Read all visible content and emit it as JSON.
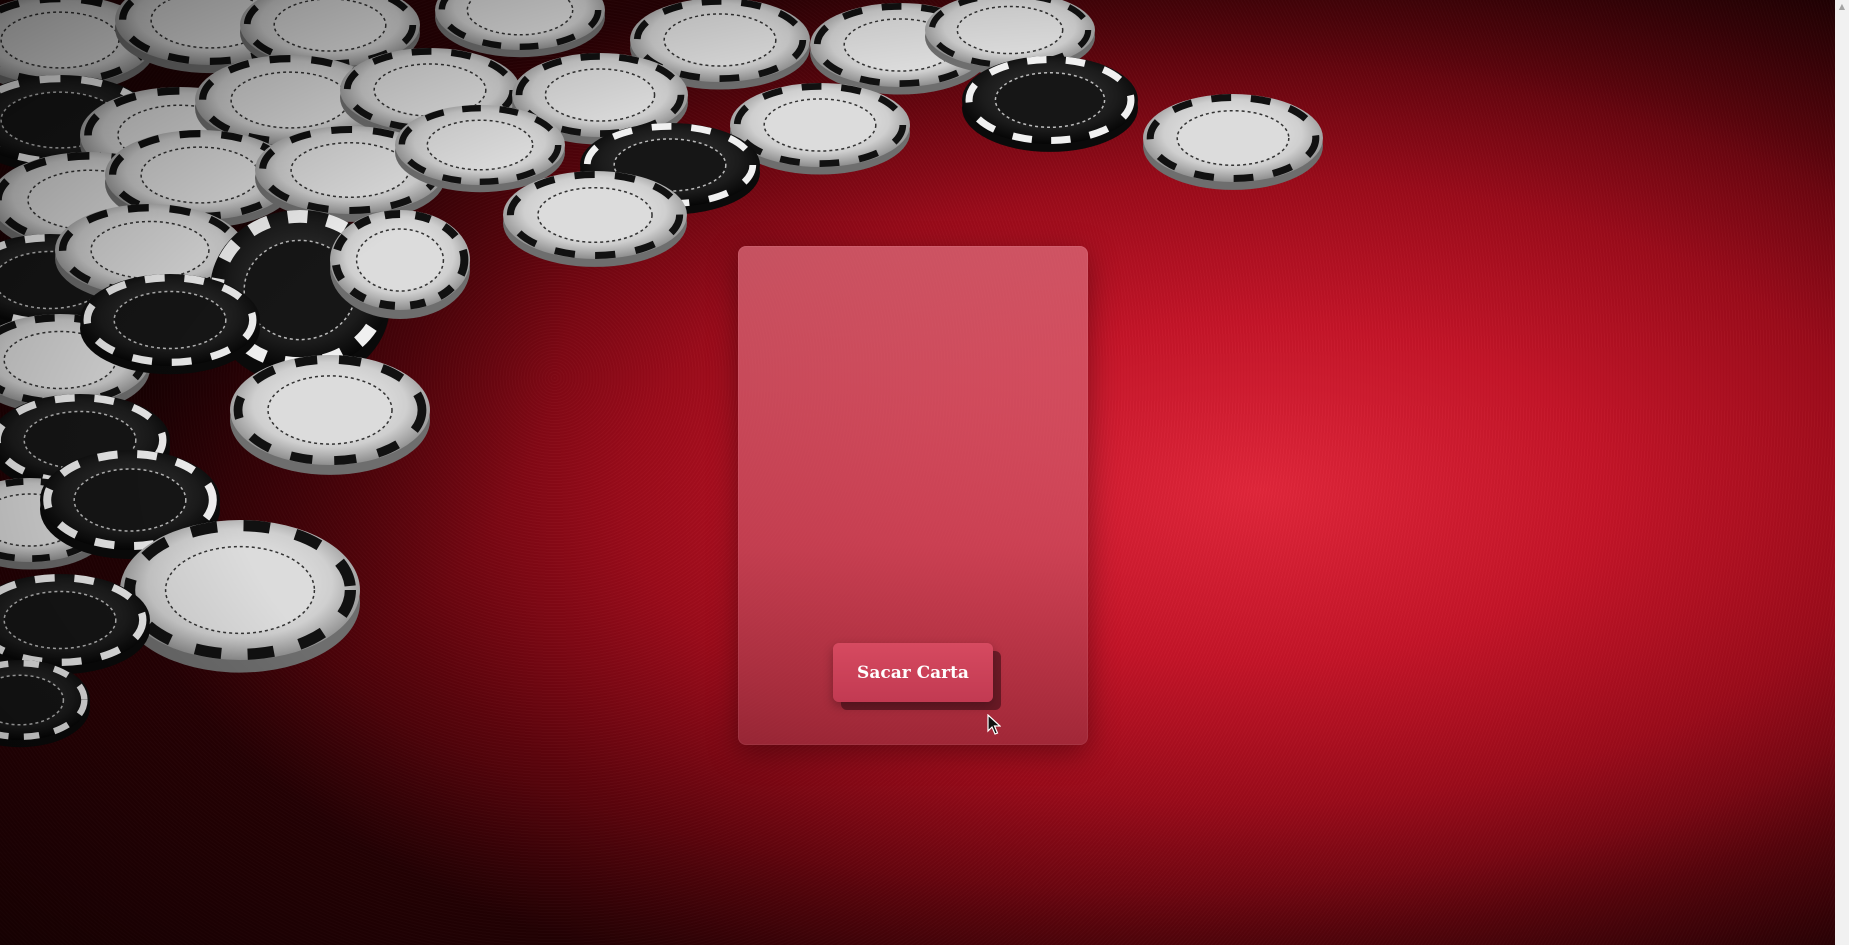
{
  "app": {
    "draw_button_label": "Sacar Carta"
  },
  "icons": {
    "cursor": "mouse-pointer-icon",
    "scroll_up": "triangle-up-icon",
    "chips": "poker-chip-icon"
  },
  "colors": {
    "felt": "#c41428",
    "panel": "#d06474",
    "button": "#c23a52",
    "button_text": "#ffffff"
  }
}
